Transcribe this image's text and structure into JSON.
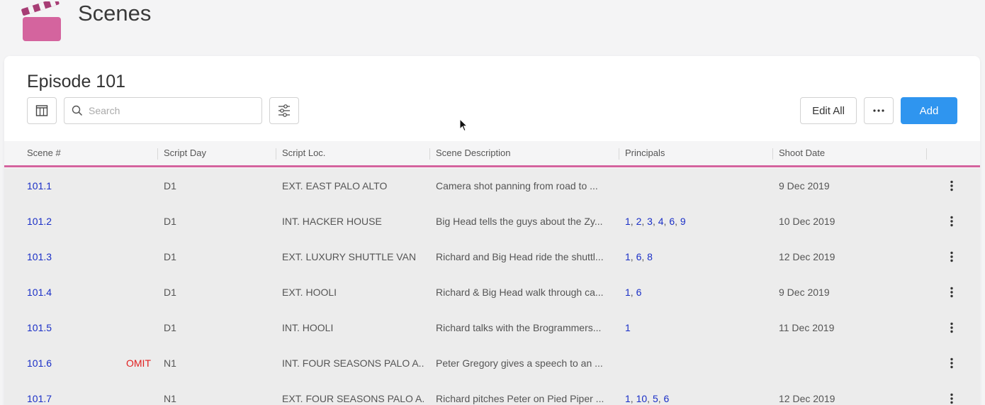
{
  "app": {
    "title": "Scenes",
    "icon": "clapperboard-icon",
    "brand_color": "#d4649e"
  },
  "episode": {
    "title": "Episode 101"
  },
  "toolbar": {
    "search_placeholder": "Search",
    "edit_all_label": "Edit All",
    "add_label": "Add"
  },
  "columns": [
    "Scene #",
    "Script Day",
    "Script Loc.",
    "Scene Description",
    "Principals",
    "Shoot Date"
  ],
  "rows": [
    {
      "scene": "101.1",
      "omit": "",
      "day": "D1",
      "loc": "EXT. EAST PALO ALTO",
      "desc": "Camera shot panning from road to ...",
      "principals": [],
      "date": "9 Dec 2019"
    },
    {
      "scene": "101.2",
      "omit": "",
      "day": "D1",
      "loc": "INT. HACKER HOUSE",
      "desc": "Big Head tells the guys about the Zy...",
      "principals": [
        "1",
        "2",
        "3",
        "4",
        "6",
        "9"
      ],
      "date": "10 Dec 2019"
    },
    {
      "scene": "101.3",
      "omit": "",
      "day": "D1",
      "loc": "EXT. LUXURY SHUTTLE VAN",
      "desc": "Richard and Big Head ride the shuttl...",
      "principals": [
        "1",
        "6",
        "8"
      ],
      "date": "12 Dec 2019"
    },
    {
      "scene": "101.4",
      "omit": "",
      "day": "D1",
      "loc": "EXT. HOOLI",
      "desc": "Richard & Big Head walk through ca...",
      "principals": [
        "1",
        "6"
      ],
      "date": "9 Dec 2019"
    },
    {
      "scene": "101.5",
      "omit": "",
      "day": "D1",
      "loc": "INT. HOOLI",
      "desc": "Richard talks with the Brogrammers...",
      "principals": [
        "1"
      ],
      "date": "11 Dec 2019"
    },
    {
      "scene": "101.6",
      "omit": "OMIT",
      "day": "N1",
      "loc": "INT. FOUR SEASONS PALO A...",
      "desc": "Peter Gregory gives a speech to an ...",
      "principals": [],
      "date": ""
    },
    {
      "scene": "101.7",
      "omit": "",
      "day": "N1",
      "loc": "EXT. FOUR SEASONS PALO A...",
      "desc": "Richard pitches Peter on Pied Piper ...",
      "principals": [
        "1",
        "10",
        "5",
        "6"
      ],
      "date": "12 Dec 2019"
    }
  ]
}
